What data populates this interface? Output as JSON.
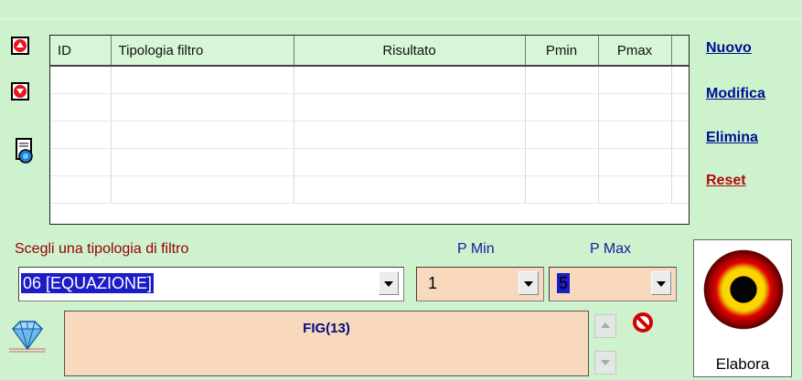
{
  "grid": {
    "columns": [
      "ID",
      "Tipologia filtro",
      "Risultato",
      "Pmin",
      "Pmax"
    ],
    "rows": [
      [
        "",
        "",
        "",
        "",
        ""
      ],
      [
        "",
        "",
        "",
        "",
        ""
      ],
      [
        "",
        "",
        "",
        "",
        ""
      ],
      [
        "",
        "",
        "",
        "",
        ""
      ],
      [
        "",
        "",
        "",
        "",
        ""
      ]
    ]
  },
  "actions": {
    "nuovo": "Nuovo",
    "modifica": "Modifica",
    "elimina": "Elimina",
    "reset": "Reset"
  },
  "filter": {
    "label": "Scegli una tipologia di filtro",
    "value": "06 [EQUAZIONE]"
  },
  "pmin": {
    "label": "P Min",
    "value": "1"
  },
  "pmax": {
    "label": "P Max",
    "value": "5"
  },
  "result": {
    "text": "FIG(13)"
  },
  "elabora": {
    "label": "Elabora"
  },
  "icons": {
    "move_up": "arrow-up-icon",
    "move_down": "arrow-down-icon",
    "export": "document-export-icon",
    "gem": "diamond-icon",
    "clear": "no-entry-icon",
    "run": "target-button-icon"
  },
  "colors": {
    "background": "#cdf2cd",
    "link": "#000f8f",
    "reset": "#b00c0c",
    "field": "#f9d9bd",
    "selection": "#1c1cc8"
  }
}
